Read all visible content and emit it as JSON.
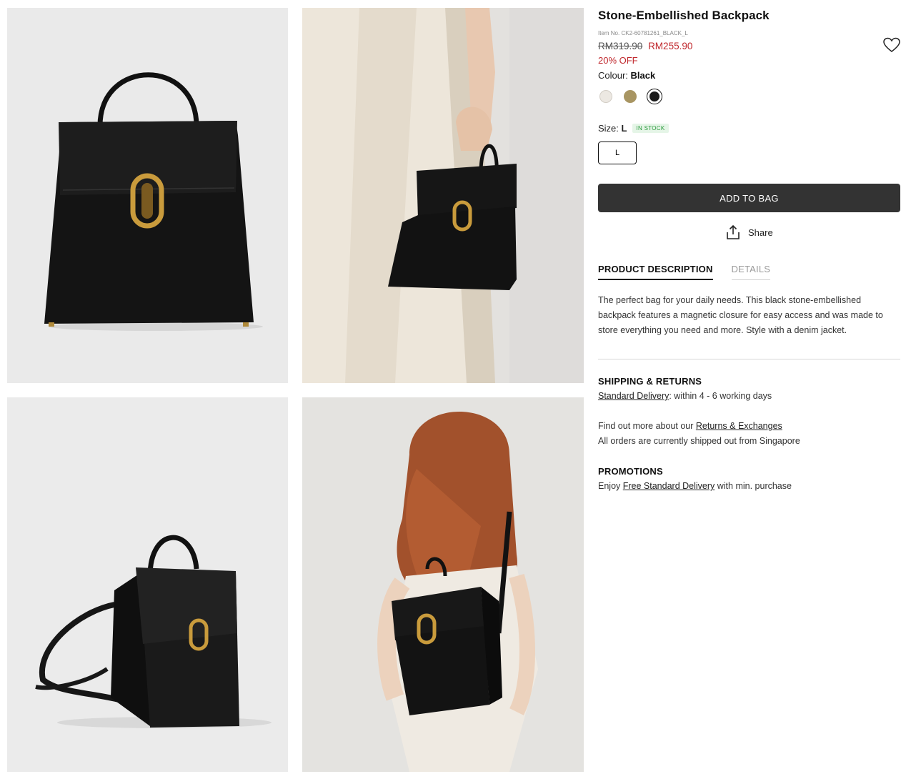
{
  "gallery": {
    "images": [
      "bag-front-photo",
      "model-holding-bag-photo",
      "bag-angled-photo",
      "model-wearing-backpack-photo"
    ]
  },
  "product": {
    "title": "Stone-Embellished Backpack",
    "item_no": "Item No. CK2-60781261_BLACK_L",
    "price_old": "RM319.90",
    "price_new": "RM255.90",
    "discount": "20% OFF",
    "colour_label": "Colour:",
    "colour_value": "Black",
    "colours": [
      {
        "name": "Chalk",
        "hex": "#ece8e2",
        "selected": false
      },
      {
        "name": "Khaki",
        "hex": "#a89562",
        "selected": false
      },
      {
        "name": "Black",
        "hex": "#1a1a1a",
        "selected": true
      }
    ],
    "size_label": "Size:",
    "size_value": "L",
    "stock": "IN STOCK",
    "size_option": "L",
    "add_to_bag": "ADD TO BAG",
    "share": "Share",
    "wishlist_icon": "heart-icon",
    "share_icon": "share-upload-icon"
  },
  "tabs": {
    "description": "PRODUCT DESCRIPTION",
    "details": "DETAILS"
  },
  "description": "The perfect bag for your daily needs. This black stone-embellished backpack features a magnetic closure for easy access and was made to store everything you need and more. Style with a denim jacket.",
  "shipping": {
    "heading": "SHIPPING & RETURNS",
    "delivery_link": "Standard Delivery",
    "delivery_text": ": within 4 - 6 working days",
    "returns_prefix": "Find out more about our ",
    "returns_link": "Returns & Exchanges",
    "shipped_from": "All orders are currently shipped out from Singapore"
  },
  "promotions": {
    "heading": "PROMOTIONS",
    "prefix": "Enjoy ",
    "link": "Free Standard Delivery",
    "suffix": " with min. purchase"
  },
  "colors": {
    "accent_red": "#c0282d",
    "button_dark": "#333333",
    "stock_green": "#2a9a3c"
  }
}
